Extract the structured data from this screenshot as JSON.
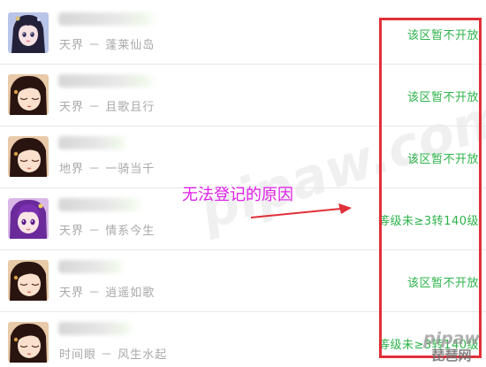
{
  "rows": [
    {
      "server": "天界 － 蓬莱仙岛",
      "status": "该区暂不开放",
      "avatar": "fairy-girl-avatar"
    },
    {
      "server": "天界 － 且歌且行",
      "status": "该区暂不开放",
      "avatar": "sleeping-girl-avatar"
    },
    {
      "server": "地界 － 一骑当千",
      "status": "该区暂不开放",
      "avatar": "sleeping-girl-avatar"
    },
    {
      "server": "天界 － 情系今生",
      "status": "等级未≥3转140级",
      "avatar": "purple-hair-girl-avatar"
    },
    {
      "server": "天界 － 逍遥如歌",
      "status": "该区暂不开放",
      "avatar": "sleeping-girl-avatar"
    },
    {
      "server": "时间眼 － 风生水起",
      "status": "等级未≥3转140级",
      "avatar": "sleeping-girl-avatar"
    }
  ],
  "annotation": "无法登记的原因",
  "watermark": "pipaw.com",
  "logo": {
    "latin": "pipaw",
    "cn": "琵琶网"
  },
  "colors": {
    "status": "#2db34a",
    "server": "#a9a9a9",
    "annotation": "#e020e8",
    "box": "#e0303a"
  }
}
